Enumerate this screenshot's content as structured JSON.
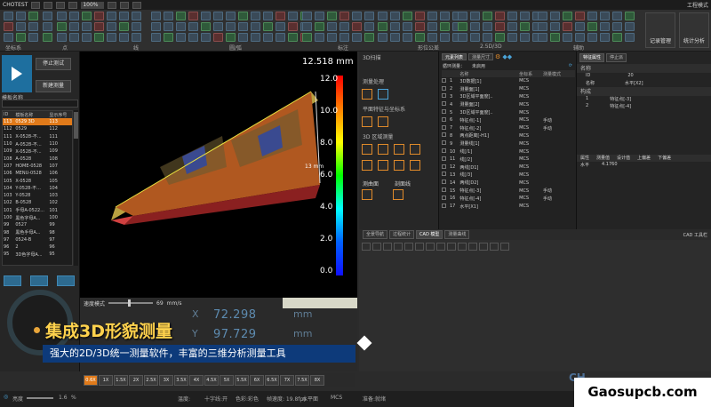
{
  "titlebar": {
    "app": "CHOTEST",
    "zoom": "100%",
    "right_label": "工程模式"
  },
  "ribbon": {
    "groups": [
      "坐标系",
      "点",
      "线",
      "圆/弧",
      "标注",
      "形位公差",
      "2.5D/3D",
      "辅助"
    ],
    "big_buttons": [
      "记录管理",
      "统计分析"
    ]
  },
  "left": {
    "stop_btn": "停止测试",
    "new_btn": "新建测量",
    "prog_label": "模板名称",
    "columns": [
      "ID",
      "模板名称",
      "显示序号"
    ],
    "rows": [
      [
        "113",
        "0529 3D",
        "113"
      ],
      [
        "112",
        "0529",
        "112"
      ],
      [
        "111",
        "X-0528-不...",
        "111"
      ],
      [
        "110",
        "A-0528-不...",
        "110"
      ],
      [
        "109",
        "X-0528-不...",
        "109"
      ],
      [
        "108",
        "A-0528",
        "108"
      ],
      [
        "107",
        "HOME-0528",
        "107"
      ],
      [
        "106",
        "MENU-0528",
        "106"
      ],
      [
        "105",
        "X-0528",
        "105"
      ],
      [
        "104",
        "Y-0528-不...",
        "104"
      ],
      [
        "103",
        "Y-0528",
        "103"
      ],
      [
        "102",
        "B-0528",
        "102"
      ],
      [
        "101",
        "手母A-0522...",
        "101"
      ],
      [
        "100",
        "黑色字母A...",
        "100"
      ],
      [
        "99",
        "0527",
        "99"
      ],
      [
        "98",
        "黑色手母A...",
        "98"
      ],
      [
        "97",
        "0524-B",
        "97"
      ],
      [
        "96",
        "2",
        "96"
      ],
      [
        "95",
        "3D色字母A...",
        "95"
      ]
    ]
  },
  "viewport": {
    "max_value": "12.518 mm",
    "ticks": [
      "12.0",
      "10.0",
      "8.0",
      "6.0",
      "4.0",
      "2.0",
      "0.0"
    ],
    "scale_label": "13 mm",
    "speed_label": "速度模式",
    "speed_value": "69",
    "speed_unit": "mm/s",
    "readout_x": "72.298",
    "readout_y": "97.729",
    "axis_x": "X",
    "axis_y": "Y",
    "unit": "mm"
  },
  "midpanel": {
    "title": "3D扫描",
    "sec1": "测量处理",
    "sec2": "平面特征与坐标系",
    "sec3": "3D 区域测量",
    "sec4a": "测曲面",
    "sec4b": "剖面线"
  },
  "table": {
    "tabs": [
      "元素列表",
      "测量尺寸"
    ],
    "subtitle": "循环测量：",
    "subtitle2": "未启用",
    "columns": [
      "",
      "",
      "名称",
      "坐标系",
      "测量模式"
    ],
    "rows": [
      [
        "1",
        "3D数据[1]",
        "MCS",
        ""
      ],
      [
        "2",
        "测量面[1]",
        "MCS",
        ""
      ],
      [
        "3",
        "3D区域平面度[..",
        "MCS",
        ""
      ],
      [
        "4",
        "测量面[2]",
        "MCS",
        ""
      ],
      [
        "5",
        "3D区域平面度[..",
        "MCS",
        ""
      ],
      [
        "6",
        "特征点[-1]",
        "MCS",
        "手动"
      ],
      [
        "7",
        "特征点[-2]",
        "MCS",
        "手动"
      ],
      [
        "8",
        "两点距离[-H1]",
        "MCS",
        ""
      ],
      [
        "9",
        "测量线[1]",
        "MCS",
        ""
      ],
      [
        "10",
        "线[/1]",
        "MCS",
        ""
      ],
      [
        "11",
        "线[/2]",
        "MCS",
        ""
      ],
      [
        "12",
        "两线[D1]",
        "MCS",
        ""
      ],
      [
        "13",
        "线[/3]",
        "MCS",
        ""
      ],
      [
        "14",
        "两线[D2]",
        "MCS",
        ""
      ],
      [
        "15",
        "特征点[-3]",
        "MCS",
        "手动"
      ],
      [
        "16",
        "特征点[-4]",
        "MCS",
        "手动"
      ],
      [
        "17",
        "水平[X1]",
        "MCS",
        ""
      ]
    ]
  },
  "props": {
    "tabs": [
      "特征属性",
      "停止派"
    ],
    "section_name": "名称",
    "id_label": "ID",
    "id_value": "20",
    "name_label": "名称",
    "name_value": "水平[X2]",
    "section_struct": "构成",
    "struct1_idx": "1",
    "struct1": "特征点[-3]",
    "struct2_idx": "2",
    "struct2": "特征点[-4]",
    "attr_cols": [
      "属性",
      "测量值",
      "设计值",
      "上偏差",
      "下偏差"
    ],
    "attr_row": [
      "水平",
      "4.1760",
      "",
      "",
      ""
    ]
  },
  "cad": {
    "tabs": [
      "全景导航",
      "过程统计",
      "CAD 模型",
      "测量曲线"
    ],
    "tool_label": "CAD 工具栏"
  },
  "zoom_levels": [
    "0.6X",
    "1X",
    "1.5X",
    "2X",
    "2.5X",
    "3X",
    "3.5X",
    "4X",
    "4.5X",
    "5X",
    "5.5X",
    "6X",
    "6.5X",
    "7X",
    "7.5X",
    "8X"
  ],
  "status": {
    "brightness_label": "亮度",
    "brightness_value": "1.6",
    "brightness_unit": "%",
    "temp": "温度:",
    "cross": "十字线:开",
    "color": "色彩:彩色",
    "fps": "帧速度: 19.8fps",
    "plane": "水平面",
    "mcs": "MCS",
    "ready": "准备:就绪"
  },
  "banner": {
    "title": "集成3D形貌测量",
    "subtitle": "强大的2D/3D统一测量软件，丰富的三维分析测量工具"
  },
  "watermark": "Gaosupcb.com",
  "ch_text": "CH"
}
